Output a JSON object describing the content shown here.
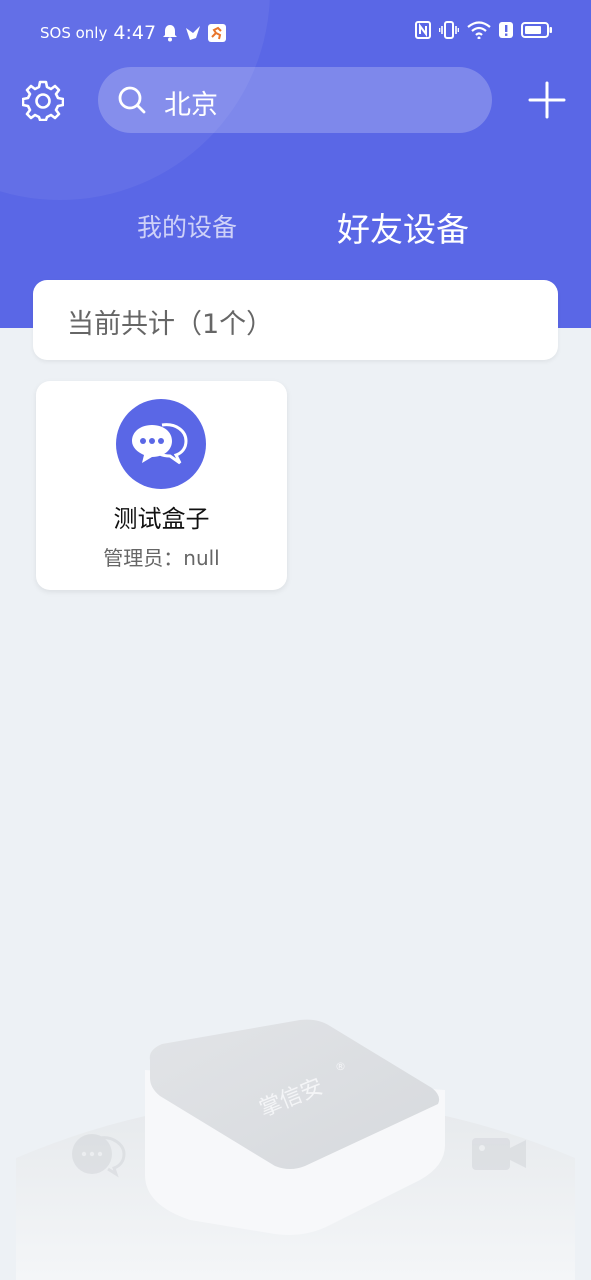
{
  "status_bar": {
    "carrier": "SOS only",
    "time": "4:47"
  },
  "header": {
    "search_value": "北京",
    "tabs": [
      {
        "label": "我的设备",
        "active": false
      },
      {
        "label": "好友设备",
        "active": true
      }
    ]
  },
  "summary": {
    "count_text": "当前共计（1个）"
  },
  "devices": [
    {
      "name": "测试盒子",
      "admin": "管理员：null"
    }
  ],
  "illustration": {
    "brand": "掌信安"
  },
  "colors": {
    "primary": "#5a67e6",
    "background": "#edf1f5"
  }
}
